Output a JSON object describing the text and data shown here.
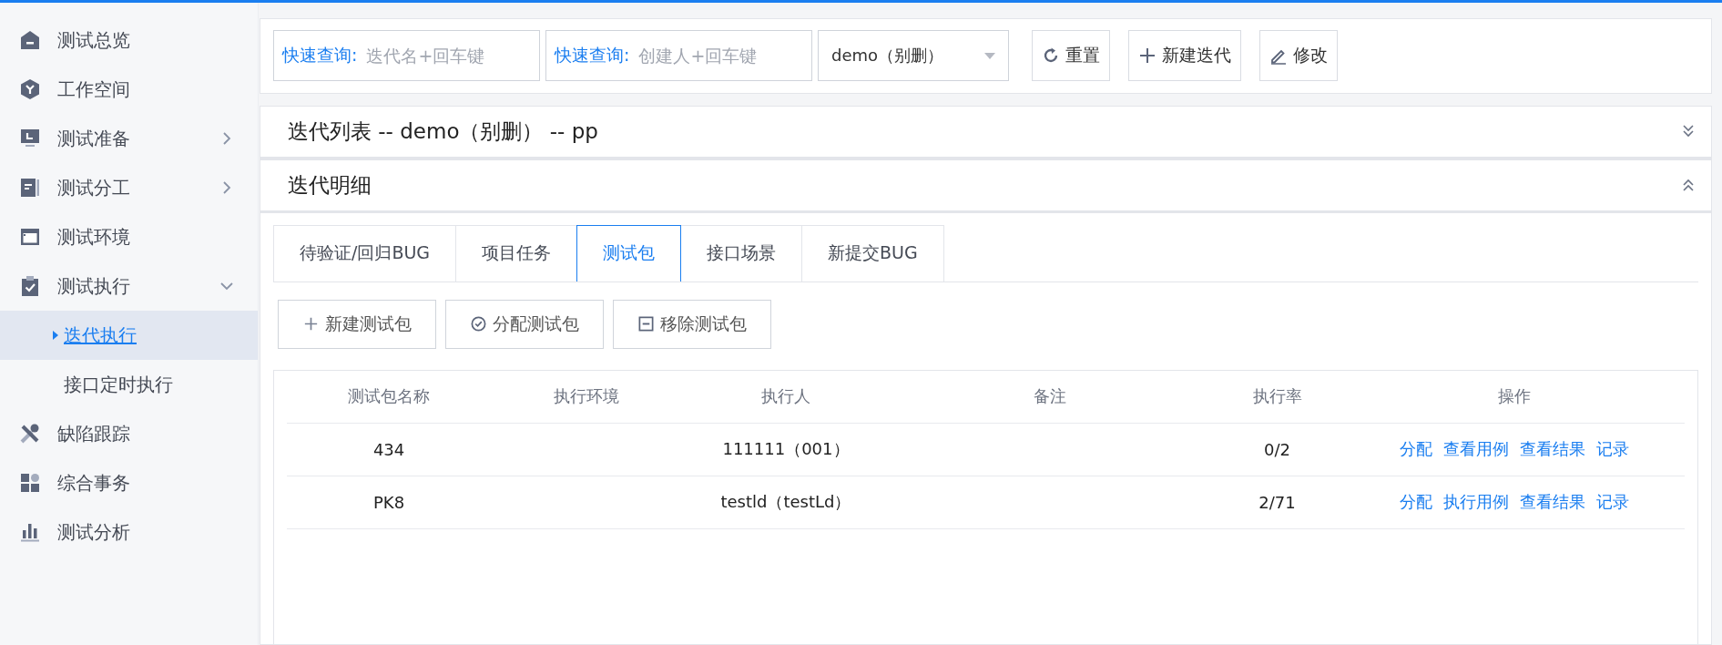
{
  "sidebar": {
    "items": [
      {
        "label": "测试总览"
      },
      {
        "label": "工作空间"
      },
      {
        "label": "测试准备",
        "expanded": false
      },
      {
        "label": "测试分工",
        "expanded": false
      },
      {
        "label": "测试环境"
      },
      {
        "label": "测试执行",
        "expanded": true,
        "children": [
          {
            "label": "迭代执行",
            "selected": true
          },
          {
            "label": "接口定时执行",
            "selected": false
          }
        ]
      },
      {
        "label": "缺陷跟踪"
      },
      {
        "label": "综合事务"
      },
      {
        "label": "测试分析"
      }
    ]
  },
  "toolbar": {
    "search_fields": [
      {
        "label": "快速查询:",
        "placeholder": "迭代名+回车键"
      },
      {
        "label": "快速查询:",
        "placeholder": "创建人+回车键"
      }
    ],
    "project_select": {
      "value": "demo（别删）"
    },
    "buttons": [
      {
        "kind": "reset",
        "label": "重置"
      },
      {
        "kind": "add",
        "label": "新建迭代"
      },
      {
        "kind": "edit",
        "label": "修改"
      }
    ]
  },
  "panels": [
    {
      "title": "迭代列表 -- demo（别删） -- pp",
      "expanded": false
    },
    {
      "title": "迭代明细",
      "expanded": true
    }
  ],
  "tabs": [
    {
      "label": "待验证/回归BUG",
      "selected": false
    },
    {
      "label": "项目任务",
      "selected": false
    },
    {
      "label": "测试包",
      "selected": true
    },
    {
      "label": "接口场景",
      "selected": false
    },
    {
      "label": "新提交BUG",
      "selected": false
    }
  ],
  "actions": [
    {
      "kind": "add",
      "label": "新建测试包"
    },
    {
      "kind": "assign",
      "label": "分配测试包"
    },
    {
      "kind": "remove",
      "label": "移除测试包"
    }
  ],
  "table": {
    "columns": [
      "测试包名称",
      "执行环境",
      "执行人",
      "备注",
      "执行率",
      "操作"
    ],
    "rows": [
      {
        "cells": [
          "434",
          "",
          "111111（001）",
          "",
          "0/2"
        ],
        "links": [
          "分配",
          "查看用例",
          "查看结果",
          "记录"
        ]
      },
      {
        "cells": [
          "PK8",
          "",
          "testld（testLd）",
          "",
          "2/71"
        ],
        "links": [
          "分配",
          "执行用例",
          "查看结果",
          "记录"
        ]
      }
    ]
  }
}
